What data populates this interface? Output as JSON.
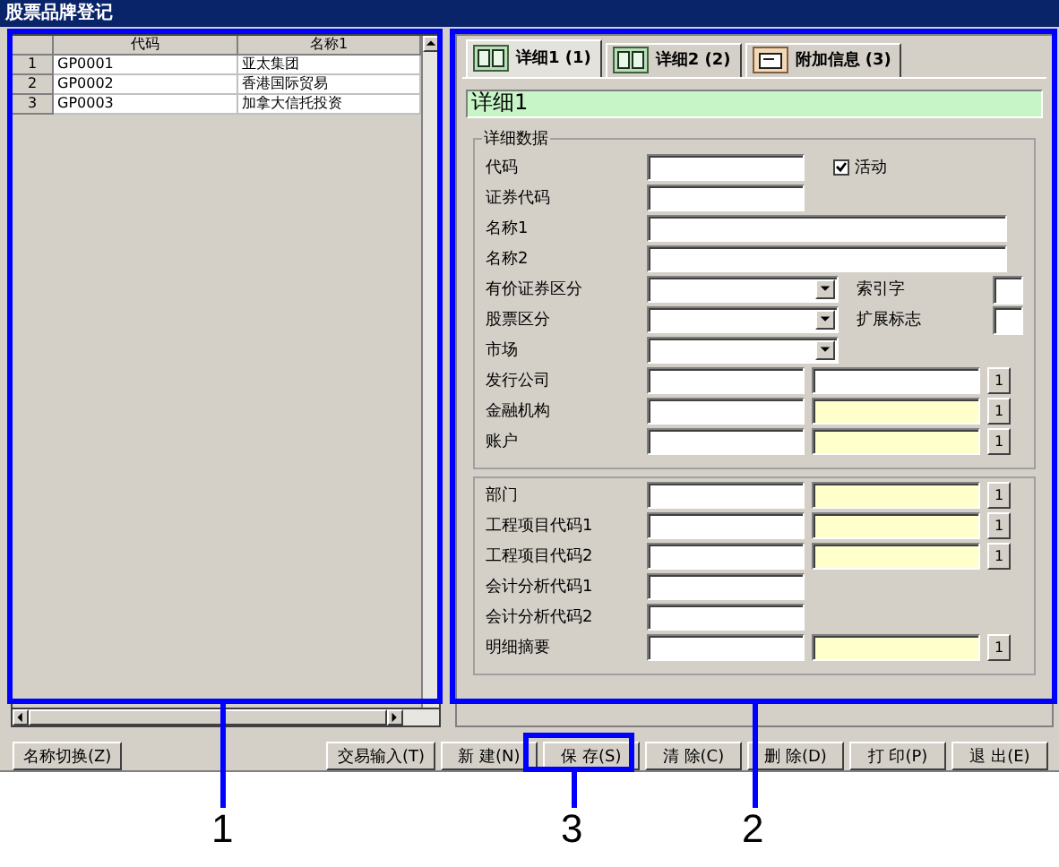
{
  "window": {
    "title": "股票品牌登记"
  },
  "grid": {
    "columns": [
      "代码",
      "名称1"
    ],
    "rows": [
      {
        "number": "1",
        "code": "GP0001",
        "name": "亚太集团"
      },
      {
        "number": "2",
        "code": "GP0002",
        "name": "香港国际贸易"
      },
      {
        "number": "3",
        "code": "GP0003",
        "name": "加拿大信托投资"
      }
    ]
  },
  "tabs": [
    {
      "label": "详细1 (1)",
      "kind": "book",
      "selected": true
    },
    {
      "label": "详细2 (2)",
      "kind": "book",
      "selected": false
    },
    {
      "label": "附加信息 (3)",
      "kind": "note",
      "selected": false
    }
  ],
  "section_title": "详细1",
  "groups": [
    {
      "title": "详细数据",
      "rows": [
        {
          "label": "代码",
          "kind": "short",
          "checkbox": {
            "label": "活动",
            "checked": true
          }
        },
        {
          "label": "证券代码",
          "kind": "short"
        },
        {
          "label": "名称1",
          "kind": "long"
        },
        {
          "label": "名称2",
          "kind": "long"
        },
        {
          "label": "有价证券区分",
          "kind": "select",
          "side_label": "索引字"
        },
        {
          "label": "股票区分",
          "kind": "select",
          "side_label": "扩展标志"
        },
        {
          "label": "市场",
          "kind": "select"
        },
        {
          "label": "发行公司",
          "kind": "lookup",
          "highlighted": false,
          "button": "1"
        },
        {
          "label": "金融机构",
          "kind": "lookup",
          "highlighted": true,
          "button": "1"
        },
        {
          "label": "账户",
          "kind": "lookup",
          "highlighted": true,
          "button": "1"
        }
      ]
    },
    {
      "rows": [
        {
          "label": "部门",
          "kind": "lookup",
          "highlighted": true,
          "button": "1"
        },
        {
          "label": "工程项目代码1",
          "kind": "lookup",
          "highlighted": true,
          "button": "1"
        },
        {
          "label": "工程项目代码2",
          "kind": "lookup",
          "highlighted": true,
          "button": "1"
        },
        {
          "label": "会计分析代码1",
          "kind": "short"
        },
        {
          "label": "会计分析代码2",
          "kind": "short"
        },
        {
          "label": "明细摘要",
          "kind": "lookup",
          "highlighted": true,
          "button": "1"
        }
      ]
    }
  ],
  "left_buttons": [
    "名称切换(Z)"
  ],
  "right_buttons": [
    "交易输入(T)",
    "新 建(N)",
    "保 存(S)",
    "清 除(C)",
    "删 除(D)",
    "打 印(P)",
    "退 出(E)"
  ],
  "callouts": [
    {
      "label": "1"
    },
    {
      "label": "3"
    },
    {
      "label": "2"
    }
  ]
}
